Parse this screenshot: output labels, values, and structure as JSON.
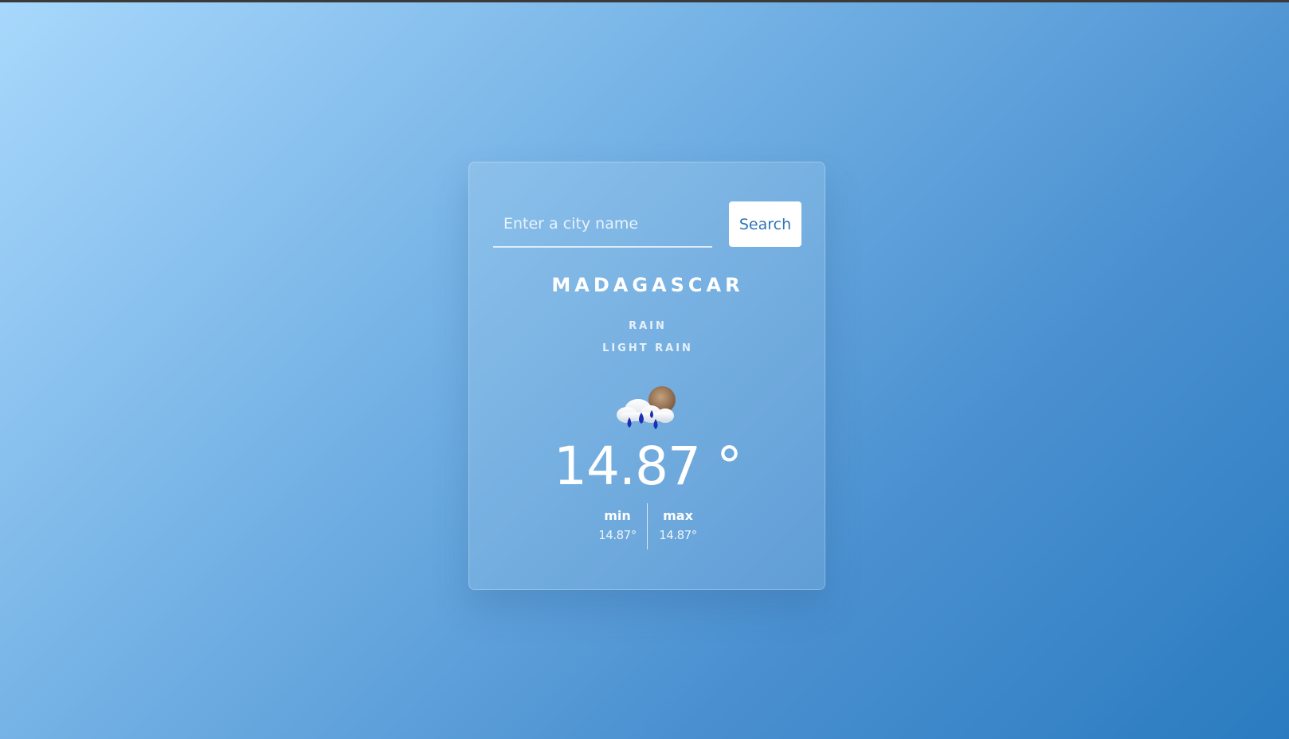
{
  "search": {
    "placeholder": "Enter a city name",
    "value": "",
    "button_label": "Search"
  },
  "weather": {
    "city": "MADAGASCAR",
    "main": "RAIN",
    "description": "LIGHT RAIN",
    "icon": "cloud-rain-sun-icon",
    "temperature": "14.87 °",
    "min_label": "min",
    "min_value": "14.87°",
    "max_label": "max",
    "max_value": "14.87°"
  },
  "colors": {
    "accent_button_text": "#2f74b7",
    "background_start": "#a8d8fc",
    "background_end": "#2a7bc0"
  }
}
